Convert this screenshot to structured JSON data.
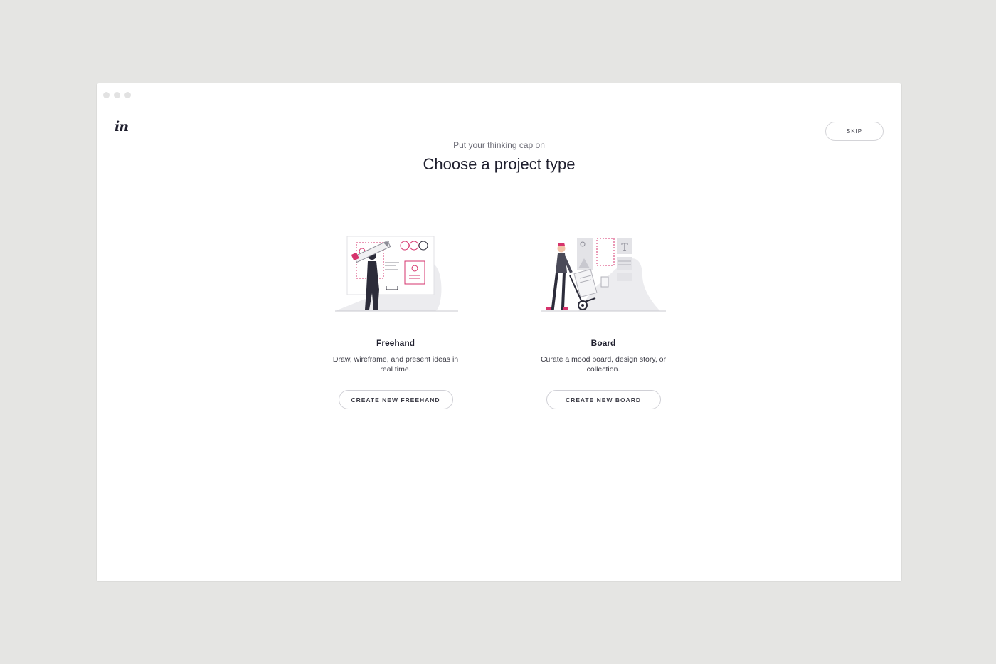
{
  "app": {
    "logo_text": "in"
  },
  "header": {
    "skip_label": "SKIP",
    "subtitle": "Put your thinking cap on",
    "title": "Choose a project type"
  },
  "cards": [
    {
      "title": "Freehand",
      "description": "Draw, wireframe, and present ideas in real time.",
      "button_label": "CREATE NEW FREEHAND",
      "illustration": "person-drawing-with-pencil"
    },
    {
      "title": "Board",
      "description": "Curate a mood board, design story, or collection.",
      "button_label": "CREATE NEW BOARD",
      "illustration": "person-pushing-hand-truck-with-boards"
    }
  ],
  "colors": {
    "background": "#e5e5e3",
    "window": "#ffffff",
    "accent": "#d6336c",
    "text_dark": "#1f1f2e"
  }
}
